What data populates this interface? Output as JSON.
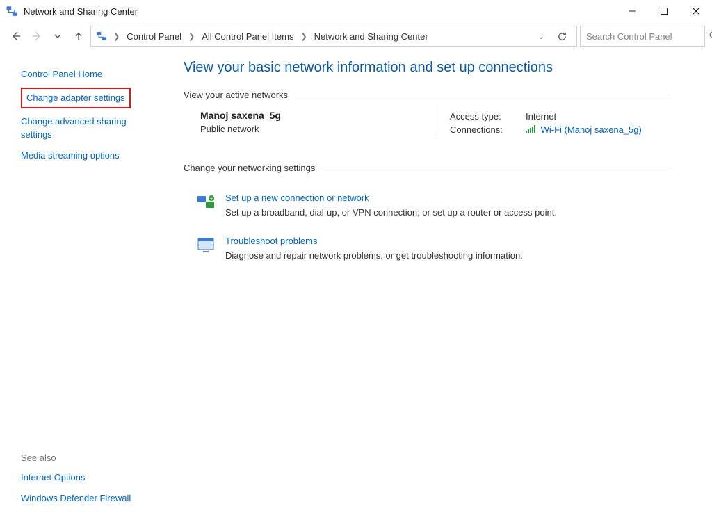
{
  "window": {
    "title": "Network and Sharing Center"
  },
  "breadcrumb": {
    "items": [
      "Control Panel",
      "All Control Panel Items",
      "Network and Sharing Center"
    ]
  },
  "search": {
    "placeholder": "Search Control Panel"
  },
  "sidebar": {
    "home": "Control Panel Home",
    "links": [
      "Change adapter settings",
      "Change advanced sharing settings",
      "Media streaming options"
    ],
    "see_also_heading": "See also",
    "see_also": [
      "Internet Options",
      "Windows Defender Firewall"
    ]
  },
  "content": {
    "title": "View your basic network information and set up connections",
    "active_heading": "View your active networks",
    "network": {
      "name": "Manoj saxena_5g",
      "type": "Public network",
      "access_label": "Access type:",
      "access_value": "Internet",
      "conn_label": "Connections:",
      "conn_value": "Wi-Fi (Manoj saxena_5g)"
    },
    "change_heading": "Change your networking settings",
    "rows": [
      {
        "title": "Set up a new connection or network",
        "desc": "Set up a broadband, dial-up, or VPN connection; or set up a router or access point."
      },
      {
        "title": "Troubleshoot problems",
        "desc": "Diagnose and repair network problems, or get troubleshooting information."
      }
    ]
  }
}
